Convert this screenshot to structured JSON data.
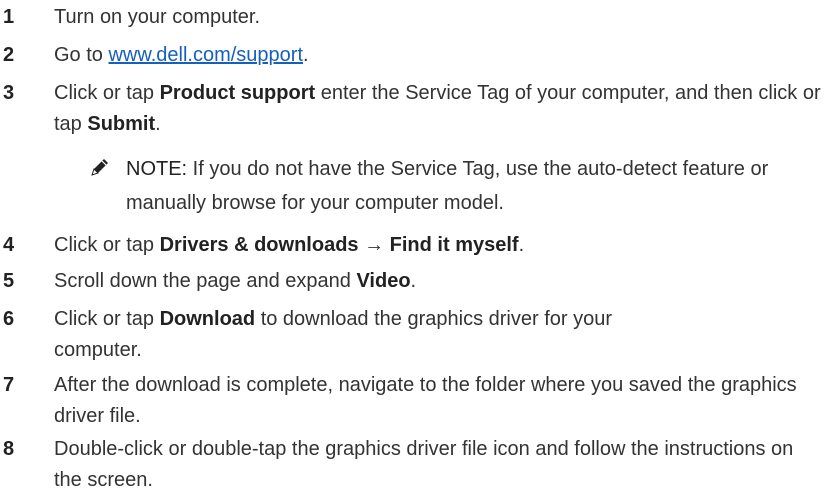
{
  "steps": [
    {
      "num": "1",
      "text": "Turn on your computer."
    },
    {
      "num": "2",
      "pre": "Go to ",
      "link": "www.dell.com/support",
      "post": "."
    },
    {
      "num": "3",
      "pre": "Click or tap ",
      "b1": "Product support",
      "mid": " enter the Service Tag of your computer, and then click or tap ",
      "b2": "Submit",
      "post": "."
    },
    {
      "num": "4",
      "pre": "Click or tap ",
      "b1": "Drivers & downloads",
      "mid": " → ",
      "b2": "Find it myself",
      "post": "."
    },
    {
      "num": "5",
      "pre": "Scroll down the page and expand ",
      "b1": "Video",
      "post": "."
    },
    {
      "num": "6",
      "pre": "Click or tap ",
      "b1": "Download",
      "post": " to download the graphics driver for your computer."
    },
    {
      "num": "7",
      "text": "After the download is complete, navigate to the folder where you saved the graphics driver file."
    },
    {
      "num": "8",
      "text": "Double-click or double-tap the graphics driver file icon and follow the instructions on the screen."
    }
  ],
  "note": {
    "label": "NOTE:",
    "text": " If you do not have the Service Tag, use the auto-detect feature or manually browse for your computer model.",
    "icon": "pencil-note-icon"
  }
}
